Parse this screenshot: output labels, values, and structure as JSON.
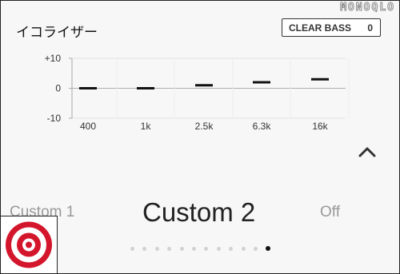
{
  "watermark": "MONOQLO",
  "header": {
    "title": "イコライザー",
    "clear_bass": {
      "label": "CLEAR BASS",
      "value": "0"
    }
  },
  "chart_data": {
    "type": "bar",
    "categories": [
      "400",
      "1k",
      "2.5k",
      "6.3k",
      "16k"
    ],
    "values": [
      0,
      0,
      1,
      2,
      3
    ],
    "ylim": [
      -10,
      10
    ],
    "yticks": [
      "+10",
      "0",
      "-10"
    ],
    "grid": true,
    "title": "",
    "xlabel": "",
    "ylabel": ""
  },
  "presets": {
    "previous": "Custom 1",
    "current": "Custom 2",
    "next": "Off"
  },
  "pager": {
    "count": 12,
    "active_index": 11
  },
  "icons": {
    "collapse": "chevron-up-icon",
    "logo": "target-logo"
  },
  "colors": {
    "logo_red": "#d3162c",
    "active_dot": "#111111",
    "inactive_dot": "#d2d2d2"
  }
}
